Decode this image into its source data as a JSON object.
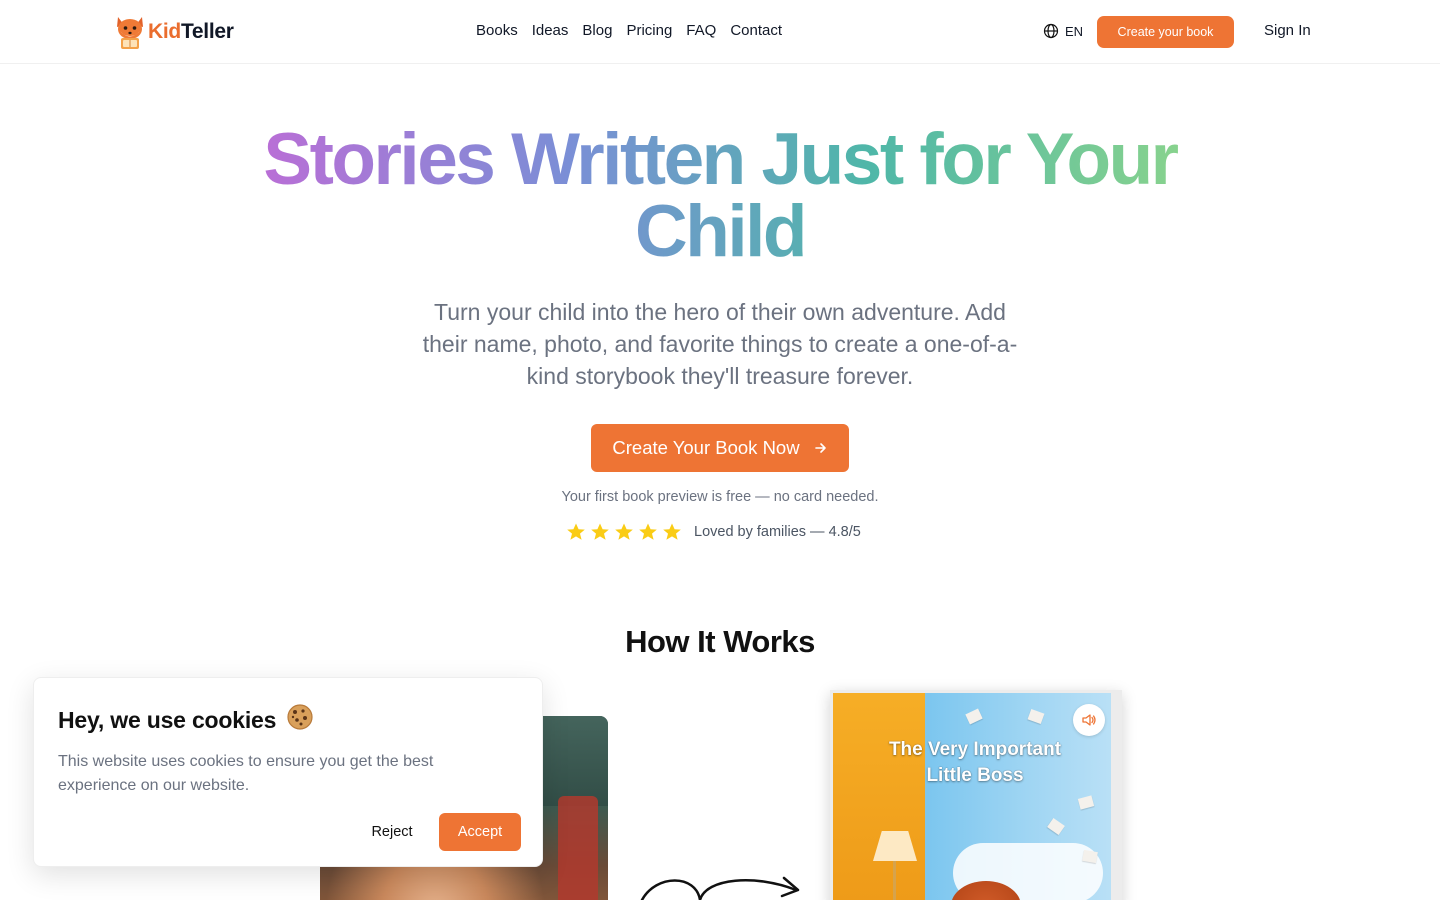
{
  "brand": {
    "name_part1": "Kid",
    "name_part2": "Teller",
    "accent": "#ee7434"
  },
  "nav": {
    "items": [
      "Books",
      "Ideas",
      "Blog",
      "Pricing",
      "FAQ",
      "Contact"
    ]
  },
  "header": {
    "language": "EN",
    "cta_label": "Create your book",
    "sign_in_label": "Sign In"
  },
  "hero": {
    "title": "Stories Written Just for Your Child",
    "subtitle": "Turn your child into the hero of their own adventure. Add their name, photo, and favorite things to create a one-of-a-kind storybook they'll treasure forever.",
    "cta_label": "Create Your Book Now",
    "note": "Your first book preview is free — no card needed.",
    "rating_text": "Loved by families — 4.8/5",
    "stars": 5
  },
  "how_it_works": {
    "title": "How It Works",
    "book_title": "The Very Important Little Boss"
  },
  "cookie_banner": {
    "title": "Hey, we use cookies",
    "text": "This website uses cookies to ensure you get the best experience on our website.",
    "reject_label": "Reject",
    "accept_label": "Accept"
  }
}
